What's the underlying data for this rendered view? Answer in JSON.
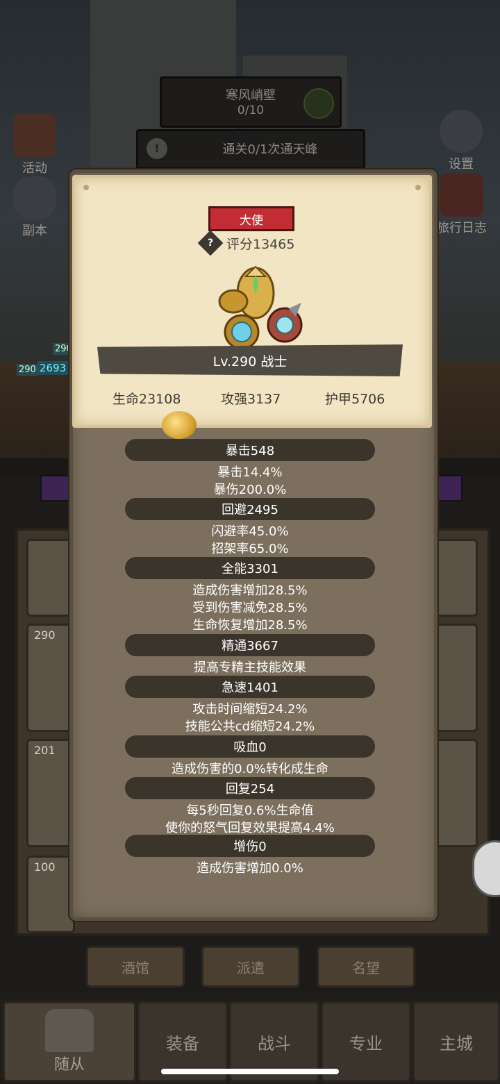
{
  "background": {
    "zone_title": "寒风峭壁",
    "zone_progress": "0/10",
    "quest_text": "通关0/1次通天峰",
    "left_icons": [
      "活动",
      "副本"
    ],
    "right_icons": [
      "设置",
      "旅行日志"
    ],
    "hero_levels": [
      "290",
      "290",
      "2693"
    ],
    "roster_levels": [
      "290",
      "201",
      "100"
    ],
    "sub_buttons": [
      "酒馆",
      "派遣",
      "名望"
    ],
    "nav_tabs": [
      "随从",
      "装备",
      "战斗",
      "专业",
      "主城"
    ]
  },
  "popup": {
    "rank": "大使",
    "score": "评分13465",
    "item_name": "Lv.290 战士",
    "stats": {
      "hp": "生命23108",
      "atk": "攻强3137",
      "armor": "护甲5706"
    },
    "groups": [
      {
        "title": "暴击548",
        "lines": [
          "暴击14.4%",
          "暴伤200.0%"
        ]
      },
      {
        "title": "回避2495",
        "lines": [
          "闪避率45.0%",
          "招架率65.0%"
        ]
      },
      {
        "title": "全能3301",
        "lines": [
          "造成伤害增加28.5%",
          "受到伤害减免28.5%",
          "生命恢复增加28.5%"
        ]
      },
      {
        "title": "精通3667",
        "lines": [
          "提高专精主技能效果"
        ]
      },
      {
        "title": "急速1401",
        "lines": [
          "攻击时间缩短24.2%",
          "技能公共cd缩短24.2%"
        ]
      },
      {
        "title": "吸血0",
        "lines": [
          "造成伤害的0.0%转化成生命"
        ]
      },
      {
        "title": "回复254",
        "lines": [
          "每5秒回复0.6%生命值",
          "使你的怒气回复效果提高4.4%"
        ]
      },
      {
        "title": "增伤0",
        "lines": [
          "造成伤害增加0.0%"
        ]
      }
    ]
  },
  "icons": [
    "help-icon",
    "gear-icon",
    "refresh-icon",
    "alert-icon",
    "helmet-icon",
    "coin-icon",
    "equipment-icon"
  ],
  "colors": {
    "rank_red": "#c22c33",
    "paper": "#f2e5c4",
    "panel": "#7c6f5d",
    "pill": "#3b342b"
  }
}
